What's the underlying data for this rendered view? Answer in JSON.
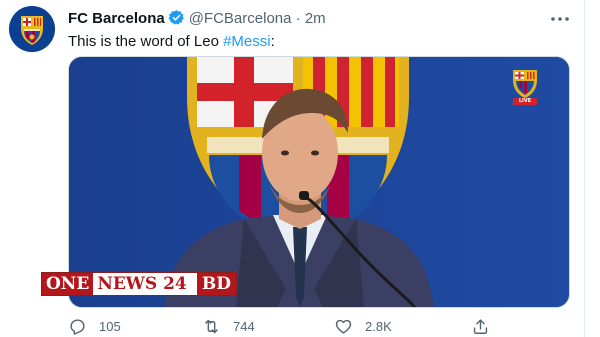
{
  "tweet": {
    "author_name": "FC Barcelona",
    "handle": "@FCBarcelona",
    "separator": "·",
    "time": "2m",
    "text_prefix": "This is the word of Leo ",
    "hashtag": "#Messi",
    "text_suffix": ":",
    "verified_icon": "verified-badge-icon",
    "more_icon": "more-options-icon"
  },
  "media": {
    "watermark_one": "ONE",
    "watermark_news": "NEWS 24",
    "watermark_bd": "BD",
    "live_badge": "LIVE"
  },
  "actions": {
    "replies": "105",
    "retweets": "744",
    "likes": "2.8K",
    "reply_icon": "reply-icon",
    "retweet_icon": "retweet-icon",
    "like_icon": "heart-icon",
    "share_icon": "share-icon"
  },
  "colors": {
    "link": "#1d9bf0",
    "muted": "#536471",
    "barca_blue": "#004d98",
    "barca_red": "#a50044"
  }
}
